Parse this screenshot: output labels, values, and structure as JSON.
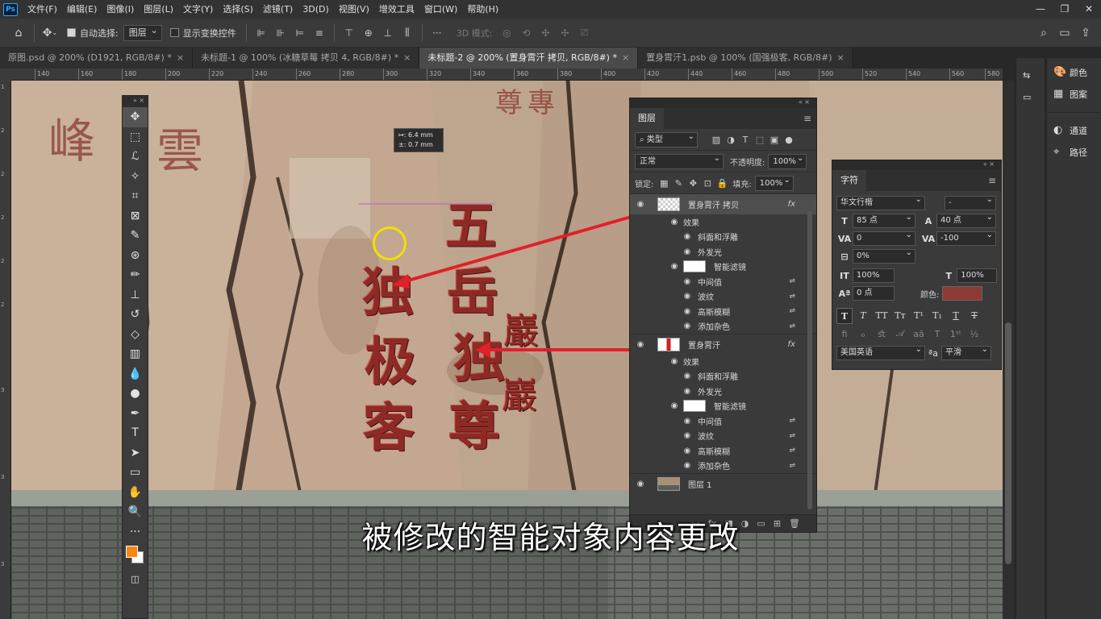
{
  "app": {
    "logo": "Ps",
    "menu": [
      "文件(F)",
      "编辑(E)",
      "图像(I)",
      "图层(L)",
      "文字(Y)",
      "选择(S)",
      "滤镜(T)",
      "3D(D)",
      "视图(V)",
      "增效工具",
      "窗口(W)",
      "帮助(H)"
    ],
    "window_controls": [
      "—",
      "❐",
      "✕"
    ]
  },
  "options": {
    "auto_select_label": "自动选择:",
    "auto_select_value": "图层",
    "show_transform_label": "显示变换控件",
    "mode_3d_label": "3D 模式:",
    "more": "···"
  },
  "tabs": [
    {
      "label": "原图.psd @ 200% (D1921, RGB/8#) *",
      "active": false
    },
    {
      "label": "未标题-1 @ 100% (冰糖草莓 拷贝 4, RGB/8#) *",
      "active": false
    },
    {
      "label": "未标题-2 @ 200% (置身霄汗 拷贝, RGB/8#) *",
      "active": true
    },
    {
      "label": "置身霄汗1.psb @ 100% (国强极客, RGB/8#)",
      "active": false
    }
  ],
  "ruler": {
    "top": [
      "140",
      "160",
      "180",
      "200",
      "220",
      "240",
      "260",
      "280",
      "300",
      "320",
      "340",
      "360",
      "380",
      "400",
      "420",
      "440",
      "460",
      "480",
      "500",
      "520",
      "540",
      "560",
      "580"
    ],
    "left": [
      "1",
      "2",
      "2",
      "2",
      "2",
      "2",
      "3",
      "3",
      "3"
    ]
  },
  "canvas": {
    "callig_right": [
      "五",
      "岳",
      "独",
      "尊"
    ],
    "callig_left": [
      "独",
      "极",
      "客"
    ],
    "callig_small": [
      "巖",
      "巖"
    ],
    "old_chars": [
      "峰",
      "雲",
      "尊",
      "專"
    ],
    "measure": {
      "dx": "↦: 6.4 mm",
      "dy": "±: 0.7 mm"
    }
  },
  "subtitle": "被修改的智能对象内容更改",
  "toolbox": {
    "tools": [
      {
        "name": "move-tool",
        "icon": "✥"
      },
      {
        "name": "marquee-tool",
        "icon": "⬚"
      },
      {
        "name": "lasso-tool",
        "icon": "ℒ"
      },
      {
        "name": "magic-wand-tool",
        "icon": "✧"
      },
      {
        "name": "crop-tool",
        "icon": "⌗"
      },
      {
        "name": "frame-tool",
        "icon": "⊠"
      },
      {
        "name": "eyedropper-tool",
        "icon": "✎"
      },
      {
        "name": "healing-tool",
        "icon": "⊛"
      },
      {
        "name": "brush-tool",
        "icon": "✏"
      },
      {
        "name": "stamp-tool",
        "icon": "⊥"
      },
      {
        "name": "history-brush-tool",
        "icon": "↺"
      },
      {
        "name": "eraser-tool",
        "icon": "◇"
      },
      {
        "name": "gradient-tool",
        "icon": "▥"
      },
      {
        "name": "blur-tool",
        "icon": "💧"
      },
      {
        "name": "dodge-tool",
        "icon": "●"
      },
      {
        "name": "pen-tool",
        "icon": "✒"
      },
      {
        "name": "type-tool",
        "icon": "T"
      },
      {
        "name": "path-select-tool",
        "icon": "➤"
      },
      {
        "name": "rectangle-tool",
        "icon": "▭"
      },
      {
        "name": "hand-tool",
        "icon": "✋"
      },
      {
        "name": "zoom-tool",
        "icon": "🔍"
      },
      {
        "name": "more-tools",
        "icon": "···"
      }
    ],
    "fg_color": "#f7870f",
    "bg_color": "#ffffff"
  },
  "layers": {
    "title": "图层",
    "kind_filter": "类型",
    "blend_mode": "正常",
    "opacity_label": "不透明度:",
    "opacity": "100%",
    "lock_label": "锁定:",
    "fill_label": "填充:",
    "fill": "100%",
    "items": [
      {
        "type": "main",
        "name": "置身霄汗 拷贝",
        "selected": true,
        "fx": "fx"
      },
      {
        "type": "effects",
        "name": "效果"
      },
      {
        "type": "effect",
        "name": "斜面和浮雕"
      },
      {
        "type": "effect",
        "name": "外发光"
      },
      {
        "type": "smart",
        "name": "智能滤镜"
      },
      {
        "type": "filter",
        "name": "中间值"
      },
      {
        "type": "filter",
        "name": "波纹"
      },
      {
        "type": "filter",
        "name": "高斯模糊"
      },
      {
        "type": "filter",
        "name": "添加杂色"
      },
      {
        "type": "main",
        "name": "置身霄汗",
        "selected": false,
        "fx": "fx"
      },
      {
        "type": "effects",
        "name": "效果"
      },
      {
        "type": "effect",
        "name": "斜面和浮雕"
      },
      {
        "type": "effect",
        "name": "外发光"
      },
      {
        "type": "smart",
        "name": "智能滤镜"
      },
      {
        "type": "filter",
        "name": "中间值"
      },
      {
        "type": "filter",
        "name": "波纹"
      },
      {
        "type": "filter",
        "name": "高斯模糊"
      },
      {
        "type": "filter",
        "name": "添加杂色"
      },
      {
        "type": "image",
        "name": "图层 1"
      }
    ]
  },
  "character": {
    "title": "字符",
    "font_family": "华文行楷",
    "font_style": "-",
    "size": "85 点",
    "leading": "40 点",
    "kerning": "0",
    "tracking": "-100",
    "tsume": "0%",
    "vscale": "100%",
    "hscale": "100%",
    "baseline": "0 点",
    "color_label": "颜色:",
    "color": "#8c3a33",
    "language": "美国英语",
    "aa_label": "ªa",
    "antialias": "平滑"
  },
  "dock": {
    "narrow": [
      "⇆",
      "▭"
    ],
    "wide": [
      {
        "icon": "🎨",
        "label": "颜色"
      },
      {
        "icon": "▦",
        "label": "图案"
      },
      {
        "icon": "◐",
        "label": "通道"
      },
      {
        "icon": "⌖",
        "label": "路径"
      }
    ]
  }
}
